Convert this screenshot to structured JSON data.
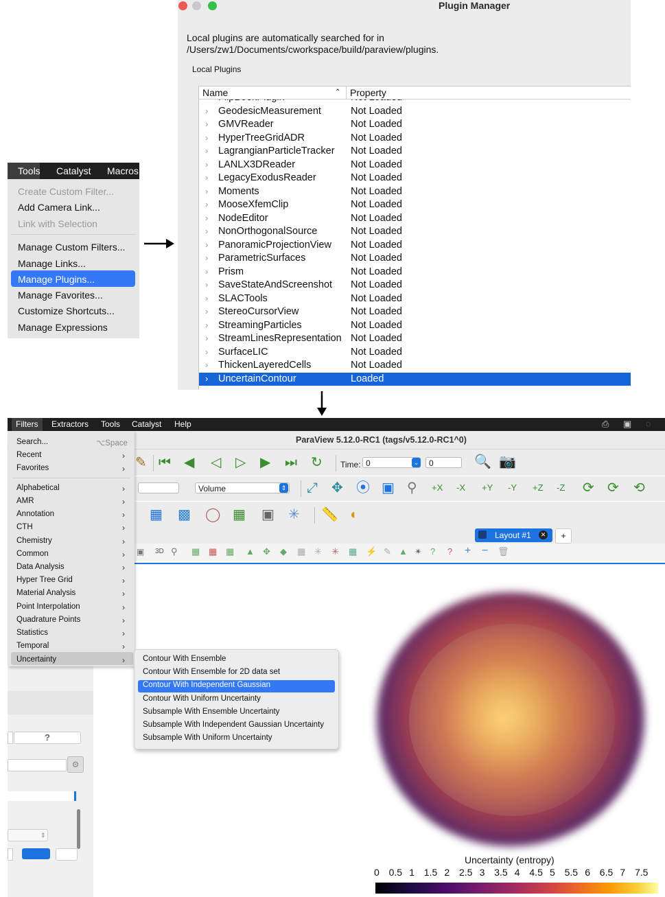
{
  "tools_menu": {
    "menubar": [
      "Tools",
      "Catalyst",
      "Macros"
    ],
    "items": [
      {
        "label": "Create Custom Filter...",
        "enabled": false
      },
      {
        "label": "Add Camera Link...",
        "enabled": true
      },
      {
        "label": "Link with Selection",
        "enabled": false
      },
      {
        "label": "Manage Custom Filters...",
        "enabled": true
      },
      {
        "label": "Manage Links...",
        "enabled": true
      },
      {
        "label": "Manage Plugins...",
        "enabled": true,
        "selected": true
      },
      {
        "label": "Manage Favorites...",
        "enabled": true
      },
      {
        "label": "Customize Shortcuts...",
        "enabled": true
      },
      {
        "label": "Manage Expressions",
        "enabled": true
      }
    ]
  },
  "plugin_manager": {
    "title": "Plugin Manager",
    "description": "Local plugins are automatically searched for in /Users/zw1/Documents/cworkspace/build/paraview/plugins.",
    "group_label": "Local Plugins",
    "columns": [
      "Name",
      "Property"
    ],
    "rows": [
      {
        "name": "FlipBookPlugin",
        "property": "Not Loaded"
      },
      {
        "name": "GeodesicMeasurement",
        "property": "Not Loaded"
      },
      {
        "name": "GMVReader",
        "property": "Not Loaded"
      },
      {
        "name": "HyperTreeGridADR",
        "property": "Not Loaded"
      },
      {
        "name": "LagrangianParticleTracker",
        "property": "Not Loaded"
      },
      {
        "name": "LANLX3DReader",
        "property": "Not Loaded"
      },
      {
        "name": "LegacyExodusReader",
        "property": "Not Loaded"
      },
      {
        "name": "Moments",
        "property": "Not Loaded"
      },
      {
        "name": "MooseXfemClip",
        "property": "Not Loaded"
      },
      {
        "name": "NodeEditor",
        "property": "Not Loaded"
      },
      {
        "name": "NonOrthogonalSource",
        "property": "Not Loaded"
      },
      {
        "name": "PanoramicProjectionView",
        "property": "Not Loaded"
      },
      {
        "name": "ParametricSurfaces",
        "property": "Not Loaded"
      },
      {
        "name": "Prism",
        "property": "Not Loaded"
      },
      {
        "name": "SaveStateAndScreenshot",
        "property": "Not Loaded"
      },
      {
        "name": "SLACTools",
        "property": "Not Loaded"
      },
      {
        "name": "StereoCursorView",
        "property": "Not Loaded"
      },
      {
        "name": "StreamingParticles",
        "property": "Not Loaded"
      },
      {
        "name": "StreamLinesRepresentation",
        "property": "Not Loaded"
      },
      {
        "name": "SurfaceLIC",
        "property": "Not Loaded"
      },
      {
        "name": "ThickenLayeredCells",
        "property": "Not Loaded"
      },
      {
        "name": "UncertainContour",
        "property": "Loaded",
        "selected": true
      }
    ]
  },
  "paraview": {
    "menubar": [
      "Filters",
      "Extractors",
      "Tools",
      "Catalyst",
      "Help"
    ],
    "title": "ParaView 5.12.0-RC1 (tags/v5.12.0-RC1^0)",
    "time_label": "Time:",
    "time_value": "0",
    "time_index": "0",
    "representation": "Volume",
    "layout_tab": "Layout #1",
    "add_tab": "+",
    "view_3d_label": "3D",
    "filters_menu": {
      "search_label": "Search...",
      "search_shortcut": "⌥Space",
      "items": [
        "Recent",
        "Favorites",
        "Alphabetical",
        "AMR",
        "Annotation",
        "CTH",
        "Chemistry",
        "Common",
        "Data Analysis",
        "Hyper Tree Grid",
        "Material Analysis",
        "Point Interpolation",
        "Quadrature Points",
        "Statistics",
        "Temporal",
        "Uncertainty"
      ]
    },
    "uncertainty_submenu": [
      "Contour With Ensemble",
      "Contour With Ensemble for 2D data set",
      "Contour With Independent Gaussian",
      "Contour With Uniform Uncertainty",
      "Subsample With Ensemble Uncertainty",
      "Subsample With Independent Gaussian Uncertainty",
      "Subsample With Uniform Uncertainty"
    ],
    "colorbar": {
      "title": "Uncertainty (entropy)",
      "ticks": [
        "0",
        "0.5",
        "1",
        "1.5",
        "2",
        "2.5",
        "3",
        "3.5",
        "4",
        "4.5",
        "5",
        "5.5",
        "6",
        "6.5",
        "7",
        "7.5"
      ]
    },
    "help_button": "?"
  },
  "colors": {
    "accent": "#3478f6",
    "selection": "#1565d8",
    "menubar": "#1f1f1f"
  }
}
